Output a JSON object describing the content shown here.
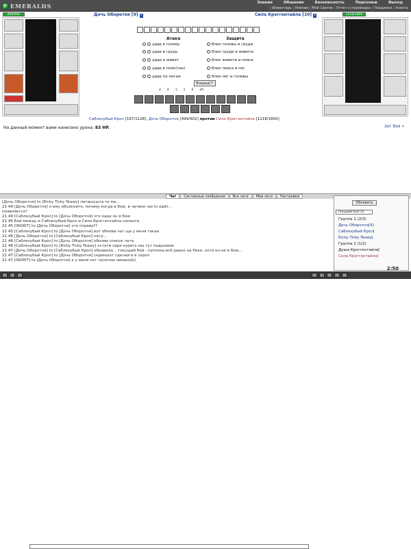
{
  "app": {
    "logo": "EMERALDS"
  },
  "menu": {
    "top": [
      "Знания",
      "Общение",
      "Безопасность",
      "Персонаж",
      "Выход"
    ],
    "sub": [
      "Инвентарь",
      "Умения",
      "Мой Свиток",
      "Отчет о переводах",
      "Поединки",
      "Анкета"
    ]
  },
  "left": {
    "hp": "499/902",
    "name": "Дочь Оборотня [9]"
  },
  "right": {
    "hp": "1218/1800",
    "name": "Сила Кроггентайла [10]"
  },
  "combat": {
    "attack_title": "Атака",
    "defense_title": "Защита",
    "attacks": [
      "удар в голову",
      "удар в грудь",
      "удар в живот",
      "удар в пояс(пах)",
      "удар по ногам"
    ],
    "defenses": [
      "блок головы и груди",
      "блок груди и живота",
      "блок живота и пояса",
      "блок пояса и ног",
      "блок ног и головы"
    ],
    "forward": "Вперед!!!",
    "stats": [
      "2",
      "0",
      "1",
      "1",
      "0",
      "20"
    ]
  },
  "vs": {
    "p1": "Саблезубый Крол",
    "p1hp": "[167/1128],",
    "p2": "Дочь Оборотня",
    "p2hp": "[499/902]",
    "mid": "против",
    "p3": "Сила Кроггентайла",
    "p3hp": "[1218/1800]"
  },
  "damage": {
    "label": "На данный момент вами нанесено урона:",
    "value": "83 HP."
  },
  "log_link": "лог боя »",
  "tabs": [
    "Чат",
    "Системные сообщения",
    "Все логи",
    "Мои логи",
    "Настройки"
  ],
  "chat": [
    {
      "time": "",
      "text": "[Дочь Оборотня] to [Ricky Ticky Teawy] паташушта те ма..."
    },
    {
      "time": "21 44",
      "text": "[Дочь Оборотня] я ему объясните, почему когда в бою, в чатике часто идёт..."
    },
    {
      "time": "",
      "text": "появляется?"
    },
    {
      "time": "21 44",
      "text": "[Саблезубый Крол] to [Дочь Оборотня] это када он в бою"
    },
    {
      "time": "21 45",
      "text": "Бой между и Саблезубый Крол и Сила Кроггентайла начался."
    },
    {
      "time": "21 45",
      "text": "[INGRIT] to [Дочь Оборотня] это справа??"
    },
    {
      "time": "21 45",
      "text": "[Саблезубый Крол] to [Дочь Оборотня] вот обнови чат ща у меня такая"
    },
    {
      "time": "21 46",
      "text": "[Дочь Оборотня] to [Саблезубый Крол] нету..."
    },
    {
      "time": "21 46",
      "text": "[Саблезубый Крол] to [Дочь Оборотня] обнови список чата"
    },
    {
      "time": "21 46",
      "text": "[Саблезубый Крол] to [Ricky Ticky Teawy] кстати харе курить мы тут падыхаем"
    },
    {
      "time": "21 47",
      "text": "[Дочь Оборотня] to [Саблезубый Крол] обновила... текущий бой - пупочка всё равно на Рике, хотя он не в бою..."
    },
    {
      "time": "21 47",
      "text": "[Саблезубый Крол] to [Дочь Оборотня] скриншот сделай и в скрол"
    },
    {
      "time": "21 47",
      "text": "[INGRIT] to [Дочь Оборотня] а у меня нет пупочки никакой))"
    }
  ],
  "side": {
    "refresh": "Обновить",
    "select": "Текущий бой (3)",
    "list": [
      "Группа 1 (2/3)",
      "Дочь Оборотня[9]",
      "Саблезубый Крол[",
      "Ricky Ticky Teawy[",
      "Группа 2 (1/2)",
      "Душа Кроггентайла[",
      "Сила Кроггентайла["
    ]
  },
  "clock": "2:50"
}
